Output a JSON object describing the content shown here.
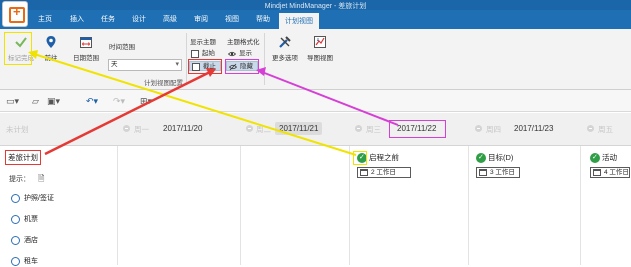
{
  "window": {
    "title": "Mindjet MindManager - 差旅计划"
  },
  "ribbon_tabs": [
    "主页",
    "插入",
    "任务",
    "设计",
    "高级",
    "审阅",
    "视图",
    "帮助",
    "计划视图"
  ],
  "ribbon": {
    "mark_complete": "标记完成",
    "goto": "前往",
    "date_range_btn": "日期范围",
    "date_range_label": "时间范围",
    "date_range_value": "天",
    "show_topics_label": "显示主题",
    "show_topics_items": [
      "起始",
      "截止"
    ],
    "topic_format_label": "主题格式化",
    "topic_format_items": [
      "显示",
      "隐藏"
    ],
    "more_options": "更多选项",
    "map_view": "导图视图",
    "group_caption": "计划视图配置"
  },
  "quick_toolbar": {
    "icons": [
      "new-icon",
      "open-icon",
      "save-icon",
      "undo-icon",
      "redo-icon",
      "layout-icon"
    ]
  },
  "calendar_header": {
    "unplanned": "未计划",
    "days": [
      {
        "weekday": "周一",
        "date": "2017/11/20"
      },
      {
        "weekday": "周二",
        "date": "2017/11/21"
      },
      {
        "weekday": "周三",
        "date": "2017/11/22"
      },
      {
        "weekday": "周四",
        "date": "2017/11/23"
      },
      {
        "weekday": "周五",
        "date": ""
      }
    ]
  },
  "left_panel": {
    "root_topic": "差旅计划",
    "hint_label": "提示：",
    "tasks": [
      "护照/签证",
      "机票",
      "酒店",
      "租车"
    ]
  },
  "tasks": [
    {
      "title": "启程之前",
      "duration": "2 工作日"
    },
    {
      "title": "目标(D)",
      "duration": "3 工作日"
    },
    {
      "title": "活动",
      "duration": "4 工作日"
    }
  ],
  "colors": {
    "ribbon_blue": "#1e6fb4",
    "annotation_red": "#e53935",
    "annotation_magenta": "#d63fd6",
    "annotation_yellow": "#f1e300",
    "complete_green": "#2f9e47"
  }
}
